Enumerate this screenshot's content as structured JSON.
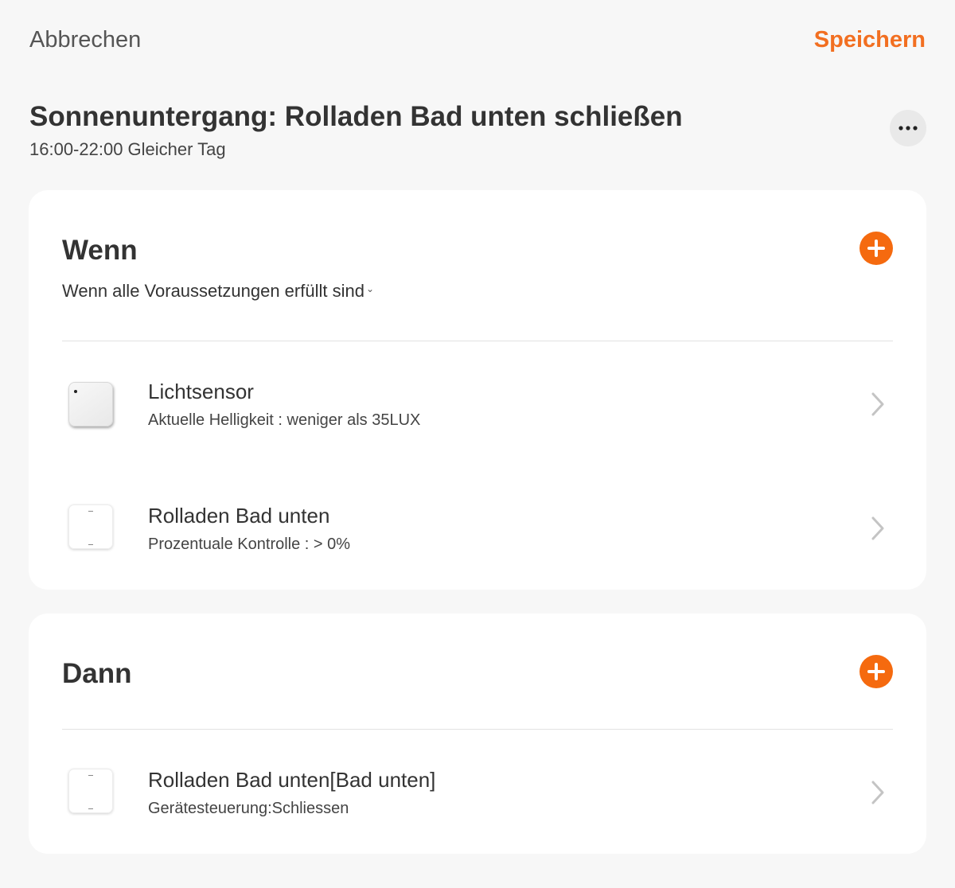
{
  "topbar": {
    "cancel_label": "Abbrechen",
    "save_label": "Speichern"
  },
  "scene": {
    "title": "Sonnenuntergang: Rolladen Bad unten schließen",
    "subtitle": "16:00-22:00 Gleicher Tag"
  },
  "colors": {
    "accent": "#f26f21",
    "add_button": "#f56a0f",
    "background": "#f7f7f7",
    "card": "#ffffff"
  },
  "if_section": {
    "title": "Wenn",
    "condition_mode": "Wenn alle Voraussetzungen erfüllt sind",
    "conditions": [
      {
        "icon": "light-sensor-icon",
        "name": "Lichtsensor",
        "detail": "Aktuelle Helligkeit : weniger als 35LUX"
      },
      {
        "icon": "curtain-controller-icon",
        "name": "Rolladen Bad unten",
        "detail": "Prozentuale Kontrolle : > 0%"
      }
    ]
  },
  "then_section": {
    "title": "Dann",
    "actions": [
      {
        "icon": "curtain-controller-icon",
        "name": "Rolladen Bad unten[Bad unten]",
        "detail": "Gerätesteuerung:Schliessen"
      }
    ]
  }
}
